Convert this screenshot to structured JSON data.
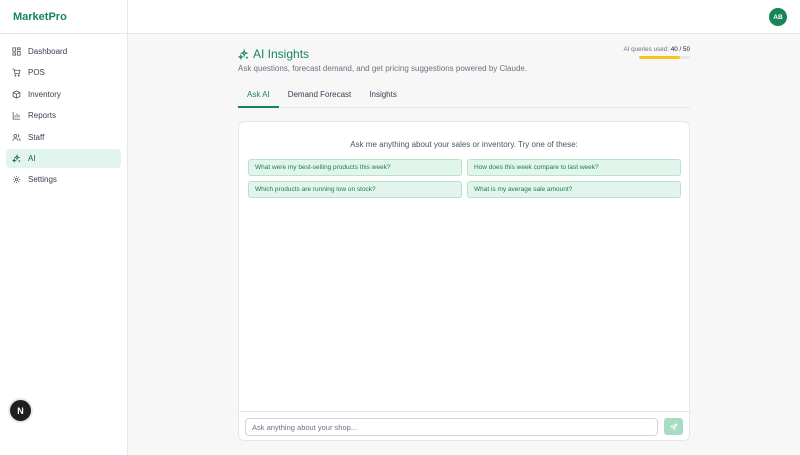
{
  "app": {
    "brand": "MarketPro",
    "user_initials": "AB",
    "next_badge": "N"
  },
  "sidebar": {
    "items": [
      {
        "label": "Dashboard",
        "icon": "dashboard-icon"
      },
      {
        "label": "POS",
        "icon": "cart-icon"
      },
      {
        "label": "Inventory",
        "icon": "box-icon"
      },
      {
        "label": "Reports",
        "icon": "bar-chart-icon"
      },
      {
        "label": "Staff",
        "icon": "users-icon"
      },
      {
        "label": "AI",
        "icon": "sparkles-icon",
        "active": true
      },
      {
        "label": "Settings",
        "icon": "gear-icon"
      }
    ]
  },
  "header": {
    "title": "AI Insights",
    "subtitle": "Ask questions, forecast demand, and get pricing suggestions powered by Claude.",
    "usage_label": "AI queries used:",
    "usage_value": "40 / 50",
    "usage_fraction": 0.8
  },
  "tabs": [
    {
      "label": "Ask AI",
      "active": true
    },
    {
      "label": "Demand Forecast"
    },
    {
      "label": "Insights"
    }
  ],
  "chat": {
    "prompt": "Ask me anything about your sales or inventory. Try one of these:",
    "suggestions": [
      "What were my best-selling products this week?",
      "How does this week compare to last week?",
      "Which products are running low on stock?",
      "What is my average sale amount?"
    ],
    "input_placeholder": "Ask anything about your shop...",
    "input_value": ""
  },
  "colors": {
    "accent": "#16855a",
    "accent_light": "#e2f5ec",
    "usage_bar": "#f5c518",
    "send_button": "#a7dcc2"
  }
}
